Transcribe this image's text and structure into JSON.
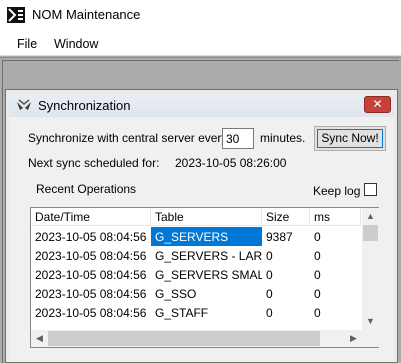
{
  "window": {
    "title": "NOM Maintenance"
  },
  "menu": {
    "items": [
      "File",
      "Window"
    ]
  },
  "dialog": {
    "title": "Synchronization",
    "close_glyph": "✕",
    "sync_prefix": "Synchronize with central server every",
    "minutes_value": "30",
    "sync_suffix": "minutes.",
    "sync_button": "Sync Now!",
    "next_sync_label": "Next sync scheduled for:",
    "next_sync_value": "2023-10-05 08:26:00",
    "recent_label": "Recent Operations",
    "keep_log_label": "Keep log",
    "keep_log_checked": false
  },
  "table": {
    "columns": [
      "Date/Time",
      "Table",
      "Size",
      "ms"
    ],
    "rows": [
      [
        "2023-10-05 08:04:56",
        "G_SERVERS",
        "9387",
        "0"
      ],
      [
        "2023-10-05 08:04:56",
        "G_SERVERS - LARG",
        "0",
        "0"
      ],
      [
        "2023-10-05 08:04:56",
        "G_SERVERS SMALL",
        "0",
        "0"
      ],
      [
        "2023-10-05 08:04:56",
        "G_SSO",
        "0",
        "0"
      ],
      [
        "2023-10-05 08:04:56",
        "G_STAFF",
        "0",
        "0"
      ]
    ],
    "selected_cell": {
      "row": 0,
      "column": 1
    }
  },
  "colors": {
    "selection": "#0078d7",
    "close_button": "#c7413a"
  },
  "icons": {
    "app": "nom-logo-icon",
    "dialog": "sync-arrows-icon"
  }
}
